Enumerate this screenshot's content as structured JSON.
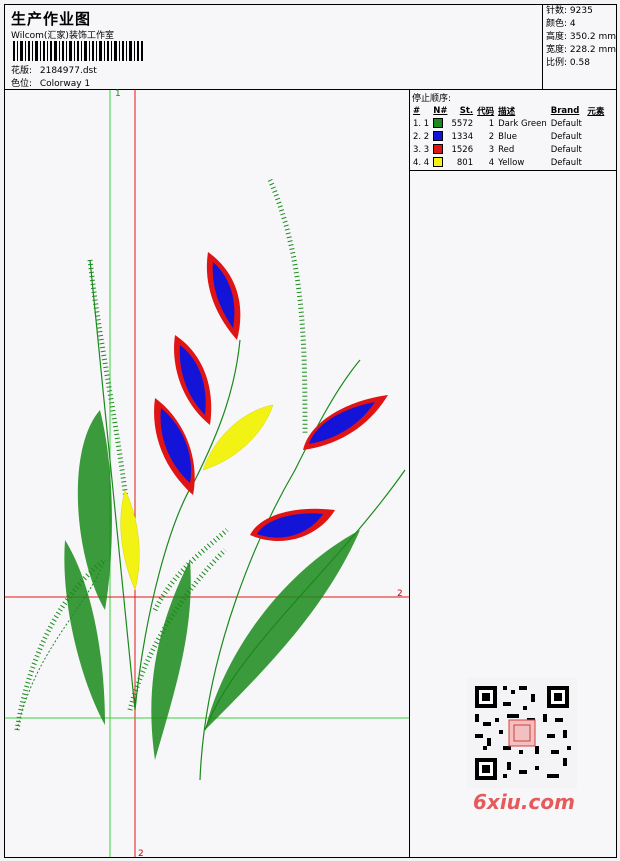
{
  "header": {
    "title": "生产作业图",
    "company": "Wilcom(汇家)装饰工作室",
    "design_label": "花版:",
    "design_value": "2184977.dst",
    "colorway_label": "色位:",
    "colorway_value": "Colorway 1"
  },
  "stats": {
    "stitches": "针数: 9235",
    "colors": "颜色: 4",
    "height": "高度: 350.2 mm",
    "width": "宽度: 228.2 mm",
    "scale": "比例: 0.58"
  },
  "stop_sequence": {
    "title": "停止顺序:",
    "headers": [
      "#",
      "N#",
      "St.",
      "代码",
      "描述",
      "Brand",
      "元素"
    ],
    "rows": [
      {
        "idx": "1. 1",
        "color": "#1a8a1a",
        "stitches": "5572",
        "code": "1",
        "desc": "Dark Green",
        "brand": "Default"
      },
      {
        "idx": "2. 2",
        "color": "#1414d8",
        "stitches": "1334",
        "code": "2",
        "desc": "Blue",
        "brand": "Default"
      },
      {
        "idx": "3. 3",
        "color": "#e01414",
        "stitches": "1526",
        "code": "3",
        "desc": "Red",
        "brand": "Default"
      },
      {
        "idx": "4. 4",
        "color": "#f2f214",
        "stitches": "801",
        "code": "4",
        "desc": "Yellow",
        "brand": "Default"
      }
    ]
  },
  "axes": {
    "top_label": "1",
    "right_label": "2",
    "bottom_label": "2"
  },
  "watermark": "6xiu.com"
}
